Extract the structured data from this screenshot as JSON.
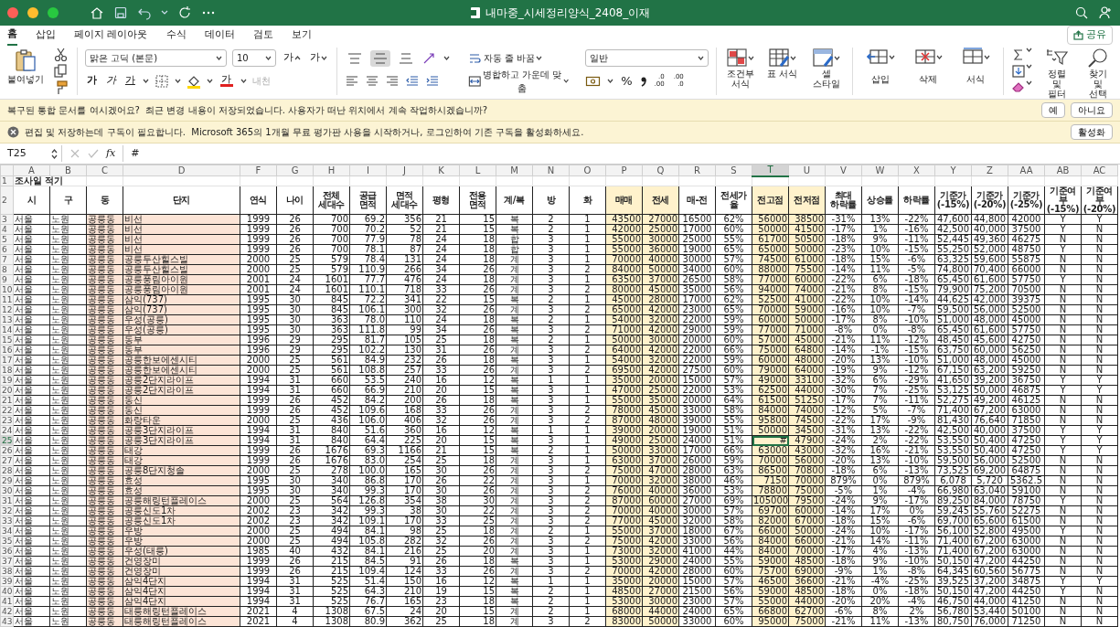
{
  "window": {
    "title": "내마중_시세정리양식_2408_이재"
  },
  "menu_tabs": [
    {
      "label": "홈",
      "selected": true
    },
    {
      "label": "삽입",
      "selected": false
    },
    {
      "label": "페이지 레이아웃",
      "selected": false
    },
    {
      "label": "수식",
      "selected": false
    },
    {
      "label": "데이터",
      "selected": false
    },
    {
      "label": "검토",
      "selected": false
    },
    {
      "label": "보기",
      "selected": false
    }
  ],
  "share_button": "공유",
  "ribbon": {
    "paste": "붙여넣기",
    "font_name": "맑은 고딕 (본문)",
    "font_size": "10",
    "grow_font": "가",
    "shrink_font": "가",
    "bold": "가",
    "italic": "가",
    "underline": "가",
    "font_color": "가",
    "phonetic": {
      "label": "내천",
      "disabled": true
    },
    "vertical_align": [
      {
        "selected": false
      },
      {
        "selected": true
      },
      {
        "selected": false
      }
    ],
    "wrap_text": "자동 줄 바꿈",
    "merge": "병합하고 가운데 맞춤",
    "number_format": "일반",
    "percent": "%",
    "decimals": [
      {
        "top": ".0",
        "bottom": ".00"
      },
      {
        "top": ".00",
        "bottom": ".0"
      }
    ],
    "styles": [
      "조건부 서식",
      "표 서식",
      "셀 스타일"
    ],
    "cells": [
      "삽입",
      "삭제",
      "서식"
    ],
    "sort_filter": "정렬 및 필터",
    "find_select": "찾기 및 선택"
  },
  "notifications": [
    {
      "kind": "info",
      "text": "복구된 통합 문서를 여시겠어요?  최근 변경 내용이 저장되었습니다. 사용자가 떠난 위치에서 계속 작업하시겠습니까?",
      "buttons": [
        "예",
        "아니요"
      ]
    },
    {
      "kind": "error",
      "text": "편집 및 저장하는데 구독이 필요합니다.  Microsoft 365의 1개월 무료 평가판 사용을 시작하거나, 로그인하여 기존 구독을 활성화하세요.",
      "buttons": [
        "활성화"
      ]
    }
  ],
  "formula_bar": {
    "cell_ref": "T25",
    "fx": "fx",
    "content": "#"
  },
  "sheet": {
    "columns": [
      {
        "letter": "A",
        "header": "시",
        "kind": "text",
        "color": "#ffffff",
        "selected": false
      },
      {
        "letter": "B",
        "header": "구",
        "kind": "text",
        "color": "#ffffff",
        "selected": false
      },
      {
        "letter": "C",
        "header": "동",
        "kind": "text",
        "color": "#fce4d6",
        "selected": false
      },
      {
        "letter": "D",
        "header": "단지",
        "kind": "text",
        "color": "#fce4d6",
        "selected": false
      },
      {
        "letter": "F",
        "header": "연식",
        "kind": "center",
        "color": "#ffffff",
        "selected": false
      },
      {
        "letter": "G",
        "header": "나이",
        "kind": "center",
        "color": "#ffffff",
        "selected": false
      },
      {
        "letter": "H",
        "header": "전체\n세대수",
        "kind": "number",
        "color": "#ffffff",
        "selected": false
      },
      {
        "letter": "I",
        "header": "공급\n면적",
        "kind": "number",
        "color": "#ffffff",
        "selected": false
      },
      {
        "letter": "J",
        "header": "면적\n세대수",
        "kind": "number",
        "color": "#ffffff",
        "selected": false
      },
      {
        "letter": "K",
        "header": "평형",
        "kind": "center",
        "color": "#ffffff",
        "selected": false
      },
      {
        "letter": "L",
        "header": "전용\n면적",
        "kind": "number",
        "color": "#ffffff",
        "selected": false
      },
      {
        "letter": "M",
        "header": "계/복",
        "kind": "center",
        "color": "#ffffff",
        "selected": false
      },
      {
        "letter": "N",
        "header": "방",
        "kind": "center",
        "color": "#ffffff",
        "selected": false
      },
      {
        "letter": "O",
        "header": "화",
        "kind": "center",
        "color": "#ffffff",
        "selected": false
      },
      {
        "letter": "P",
        "header": "매매",
        "kind": "number",
        "color": "#fff2cc",
        "header_highlight": true,
        "selected": false
      },
      {
        "letter": "Q",
        "header": "전세",
        "kind": "number",
        "color": "#fff2cc",
        "header_highlight": true,
        "selected": false
      },
      {
        "letter": "R",
        "header": "매-전",
        "kind": "center",
        "color": "#ffffff",
        "selected": false
      },
      {
        "letter": "S",
        "header": "전세가율",
        "kind": "center",
        "color": "#ffffff",
        "selected": false
      },
      {
        "letter": "T",
        "header": "전고점",
        "kind": "number",
        "color": "#fff2cc",
        "header_highlight": true,
        "selected": true
      },
      {
        "letter": "U",
        "header": "전저점",
        "kind": "number",
        "color": "#fff2cc",
        "header_highlight": true,
        "selected": false
      },
      {
        "letter": "V",
        "header": "최대\n하락률",
        "kind": "center",
        "color": "#ffffff",
        "selected": false
      },
      {
        "letter": "W",
        "header": "상승률",
        "kind": "center",
        "color": "#ffffff",
        "selected": false
      },
      {
        "letter": "X",
        "header": "하락률",
        "kind": "center",
        "color": "#ffffff",
        "selected": false
      },
      {
        "letter": "Y",
        "header": "기준가\n(-15%)",
        "kind": "center",
        "color": "#ffffff",
        "selected": false
      },
      {
        "letter": "Z",
        "header": "기준가\n(-20%)",
        "kind": "center",
        "color": "#ffffff",
        "selected": false
      },
      {
        "letter": "AA",
        "header": "기준가\n(-25%)",
        "kind": "center",
        "color": "#ffffff",
        "selected": false
      },
      {
        "letter": "AB",
        "header": "기준여부\n(-15%)",
        "kind": "center",
        "color": "#ffffff",
        "selected": false
      },
      {
        "letter": "AC",
        "header": "기준여부\n(-20%)",
        "kind": "center",
        "color": "#ffffff",
        "selected": false
      }
    ],
    "title_row": {
      "num": "1",
      "text": "조사일 적기",
      "selected": false
    },
    "header_row": {
      "num": "2",
      "selected": false
    },
    "rows": [
      {
        "num": "3",
        "selected": false,
        "cells": [
          "서울",
          "노원",
          "공릉동",
          "비선",
          "1999",
          "26",
          "700",
          "69.2",
          "356",
          "21",
          "15",
          "복",
          "2",
          "1",
          "43500",
          "27000",
          "16500",
          "62%",
          "56000",
          "38500",
          "-31%",
          "13%",
          "-22%",
          "47,600",
          "44,800",
          "42000",
          "Y",
          "Y"
        ]
      },
      {
        "num": "4",
        "selected": false,
        "cells": [
          "서울",
          "노원",
          "공릉동",
          "비선",
          "1999",
          "26",
          "700",
          "70.2",
          "52",
          "21",
          "15",
          "복",
          "2",
          "1",
          "42000",
          "25000",
          "17000",
          "60%",
          "50000",
          "41500",
          "-17%",
          "1%",
          "-16%",
          "42,500",
          "40,000",
          "37500",
          "Y",
          "N"
        ]
      },
      {
        "num": "5",
        "selected": false,
        "cells": [
          "서울",
          "노원",
          "공릉동",
          "비선",
          "1999",
          "26",
          "700",
          "77.9",
          "78",
          "24",
          "18",
          "합",
          "3",
          "1",
          "55000",
          "30000",
          "25000",
          "55%",
          "61700",
          "50500",
          "-18%",
          "9%",
          "-11%",
          "52,445",
          "49,360",
          "46275",
          "N",
          "N"
        ]
      },
      {
        "num": "6",
        "selected": false,
        "cells": [
          "서울",
          "노원",
          "공릉동",
          "비선",
          "1999",
          "26",
          "700",
          "78.1",
          "87",
          "24",
          "18",
          "합",
          "3",
          "1",
          "55000",
          "36000",
          "19000",
          "65%",
          "65000",
          "50000",
          "-23%",
          "10%",
          "-15%",
          "55,250",
          "52,000",
          "48750",
          "Y",
          "N"
        ]
      },
      {
        "num": "7",
        "selected": false,
        "cells": [
          "서울",
          "노원",
          "공릉동",
          "공릉두산힐스빌",
          "2000",
          "25",
          "579",
          "78.4",
          "131",
          "24",
          "18",
          "계",
          "3",
          "1",
          "70000",
          "40000",
          "30000",
          "57%",
          "74500",
          "61000",
          "-18%",
          "15%",
          "-6%",
          "63,325",
          "59,600",
          "55875",
          "N",
          "N"
        ]
      },
      {
        "num": "8",
        "selected": false,
        "cells": [
          "서울",
          "노원",
          "공릉동",
          "공릉두산힐스빌",
          "2000",
          "25",
          "579",
          "110.9",
          "266",
          "34",
          "26",
          "계",
          "3",
          "2",
          "84000",
          "50000",
          "34000",
          "60%",
          "88000",
          "75500",
          "-14%",
          "11%",
          "-5%",
          "74,800",
          "70,400",
          "66000",
          "N",
          "N"
        ]
      },
      {
        "num": "9",
        "selected": false,
        "cells": [
          "서울",
          "노원",
          "공릉동",
          "공릉풍림아이원",
          "2001",
          "24",
          "1601",
          "77.7",
          "476",
          "24",
          "18",
          "계",
          "3",
          "1",
          "63500",
          "37000",
          "26500",
          "58%",
          "77000",
          "60000",
          "-22%",
          "6%",
          "-18%",
          "65,450",
          "61,600",
          "57750",
          "Y",
          "N"
        ]
      },
      {
        "num": "10",
        "selected": false,
        "cells": [
          "서울",
          "노원",
          "공릉동",
          "공릉풍림아이원",
          "2001",
          "24",
          "1601",
          "110.1",
          "718",
          "33",
          "26",
          "계",
          "3",
          "2",
          "80000",
          "45000",
          "35000",
          "56%",
          "94000",
          "74000",
          "-21%",
          "8%",
          "-15%",
          "79,900",
          "75,200",
          "70500",
          "N",
          "N"
        ]
      },
      {
        "num": "11",
        "selected": false,
        "cells": [
          "서울",
          "노원",
          "공릉동",
          "삼익(737)",
          "1995",
          "30",
          "845",
          "72.2",
          "341",
          "22",
          "15",
          "복",
          "2",
          "1",
          "45000",
          "28000",
          "17000",
          "62%",
          "52500",
          "41000",
          "-22%",
          "10%",
          "-14%",
          "44,625",
          "42,000",
          "39375",
          "N",
          "N"
        ]
      },
      {
        "num": "12",
        "selected": false,
        "cells": [
          "서울",
          "노원",
          "공릉동",
          "삼익(737)",
          "1995",
          "30",
          "845",
          "106.1",
          "300",
          "32",
          "26",
          "계",
          "3",
          "2",
          "65000",
          "42000",
          "23000",
          "65%",
          "70000",
          "59000",
          "-16%",
          "10%",
          "-7%",
          "59,500",
          "56,000",
          "52500",
          "N",
          "N"
        ]
      },
      {
        "num": "13",
        "selected": false,
        "cells": [
          "서울",
          "노원",
          "공릉동",
          "우성(공릉)",
          "1995",
          "30",
          "363",
          "78.0",
          "110",
          "24",
          "18",
          "복",
          "2",
          "1",
          "54000",
          "32000",
          "22000",
          "59%",
          "60000",
          "50000",
          "-17%",
          "8%",
          "-10%",
          "51,000",
          "48,000",
          "45000",
          "N",
          "N"
        ]
      },
      {
        "num": "14",
        "selected": false,
        "cells": [
          "서울",
          "노원",
          "공릉동",
          "우성(공릉)",
          "1995",
          "30",
          "363",
          "111.8",
          "99",
          "34",
          "26",
          "복",
          "3",
          "2",
          "71000",
          "42000",
          "29000",
          "59%",
          "77000",
          "71000",
          "-8%",
          "0%",
          "-8%",
          "65,450",
          "61,600",
          "57750",
          "N",
          "N"
        ]
      },
      {
        "num": "15",
        "selected": false,
        "cells": [
          "서울",
          "노원",
          "공릉동",
          "동부",
          "1996",
          "29",
          "295",
          "81.7",
          "105",
          "25",
          "18",
          "복",
          "2",
          "1",
          "50000",
          "30000",
          "20000",
          "60%",
          "57000",
          "45000",
          "-21%",
          "11%",
          "-12%",
          "48,450",
          "45,600",
          "42750",
          "N",
          "N"
        ]
      },
      {
        "num": "16",
        "selected": false,
        "cells": [
          "서울",
          "노원",
          "공릉동",
          "동부",
          "1996",
          "29",
          "295",
          "102.2",
          "130",
          "31",
          "26",
          "계",
          "3",
          "2",
          "64000",
          "42000",
          "22000",
          "66%",
          "75000",
          "64800",
          "-14%",
          "-1%",
          "-15%",
          "63,750",
          "60,000",
          "56250",
          "N",
          "N"
        ]
      },
      {
        "num": "17",
        "selected": false,
        "cells": [
          "서울",
          "노원",
          "공릉동",
          "공릉한보에센시티",
          "2000",
          "25",
          "561",
          "84.9",
          "232",
          "26",
          "18",
          "복",
          "3",
          "1",
          "54000",
          "32000",
          "22000",
          "59%",
          "60000",
          "48000",
          "-20%",
          "13%",
          "-10%",
          "51,000",
          "48,000",
          "45000",
          "N",
          "N"
        ]
      },
      {
        "num": "18",
        "selected": false,
        "cells": [
          "서울",
          "노원",
          "공릉동",
          "공릉한보에센시티",
          "2000",
          "25",
          "561",
          "108.8",
          "257",
          "33",
          "26",
          "계",
          "3",
          "2",
          "69500",
          "42000",
          "27500",
          "60%",
          "79000",
          "64000",
          "-19%",
          "9%",
          "-12%",
          "67,150",
          "63,200",
          "59250",
          "N",
          "N"
        ]
      },
      {
        "num": "19",
        "selected": false,
        "cells": [
          "서울",
          "노원",
          "공릉동",
          "공릉2단지라이프",
          "1994",
          "31",
          "660",
          "53.5",
          "240",
          "16",
          "12",
          "복",
          "1",
          "1",
          "35000",
          "20000",
          "15000",
          "57%",
          "49000",
          "33100",
          "-32%",
          "6%",
          "-29%",
          "41,650",
          "39,200",
          "36750",
          "Y",
          "Y"
        ]
      },
      {
        "num": "20",
        "selected": false,
        "cells": [
          "서울",
          "노원",
          "공릉동",
          "공릉2단지라이프",
          "1994",
          "31",
          "660",
          "66.9",
          "210",
          "20",
          "15",
          "복",
          "3",
          "1",
          "47000",
          "25000",
          "22000",
          "53%",
          "62500",
          "44000",
          "-30%",
          "7%",
          "-25%",
          "53,125",
          "50,000",
          "46875",
          "Y",
          "Y"
        ]
      },
      {
        "num": "21",
        "selected": false,
        "cells": [
          "서울",
          "노원",
          "공릉동",
          "동신",
          "1999",
          "26",
          "452",
          "84.2",
          "200",
          "26",
          "18",
          "복",
          "3",
          "1",
          "55000",
          "35000",
          "20000",
          "64%",
          "61500",
          "51250",
          "-17%",
          "7%",
          "-11%",
          "52,275",
          "49,200",
          "46125",
          "N",
          "N"
        ]
      },
      {
        "num": "22",
        "selected": false,
        "cells": [
          "서울",
          "노원",
          "공릉동",
          "동신",
          "1999",
          "26",
          "452",
          "109.6",
          "168",
          "33",
          "26",
          "계",
          "3",
          "2",
          "78000",
          "45000",
          "33000",
          "58%",
          "84000",
          "74000",
          "-12%",
          "5%",
          "-7%",
          "71,400",
          "67,200",
          "63000",
          "N",
          "N"
        ]
      },
      {
        "num": "23",
        "selected": false,
        "cells": [
          "서울",
          "노원",
          "공릉동",
          "화랑타운",
          "2000",
          "25",
          "436",
          "106.0",
          "406",
          "32",
          "26",
          "계",
          "3",
          "2",
          "87000",
          "48000",
          "39000",
          "55%",
          "95800",
          "74500",
          "-22%",
          "17%",
          "-9%",
          "81,430",
          "76,640",
          "71850",
          "N",
          "N"
        ]
      },
      {
        "num": "24",
        "selected": false,
        "cells": [
          "서울",
          "노원",
          "공릉동",
          "공릉3단지라이프",
          "1994",
          "31",
          "840",
          "51.6",
          "360",
          "16",
          "12",
          "복",
          "1",
          "1",
          "39000",
          "20000",
          "19000",
          "51%",
          "50000",
          "34500",
          "-31%",
          "13%",
          "-22%",
          "42,500",
          "40,000",
          "37500",
          "Y",
          "Y"
        ]
      },
      {
        "num": "25",
        "selected": true,
        "cells": [
          "서울",
          "노원",
          "공릉동",
          "공릉3단지라이프",
          "1994",
          "31",
          "840",
          "64.4",
          "225",
          "20",
          "15",
          "복",
          "3",
          "1",
          "49000",
          "25000",
          "24000",
          "51%",
          "#",
          "47900",
          "-24%",
          "2%",
          "-22%",
          "53,550",
          "50,400",
          "47250",
          "Y",
          "Y"
        ]
      },
      {
        "num": "26",
        "selected": false,
        "cells": [
          "서울",
          "노원",
          "공릉동",
          "태강",
          "1999",
          "26",
          "1676",
          "69.3",
          "1166",
          "21",
          "15",
          "복",
          "2",
          "1",
          "50000",
          "33000",
          "17000",
          "66%",
          "63000",
          "43000",
          "-32%",
          "16%",
          "-21%",
          "53,550",
          "50,400",
          "47250",
          "Y",
          "Y"
        ]
      },
      {
        "num": "27",
        "selected": false,
        "cells": [
          "서울",
          "노원",
          "공릉동",
          "태강",
          "1999",
          "26",
          "1676",
          "83.0",
          "254",
          "25",
          "18",
          "계",
          "3",
          "1",
          "63000",
          "37000",
          "26000",
          "59%",
          "70000",
          "56000",
          "-20%",
          "13%",
          "-10%",
          "59,500",
          "56,000",
          "52500",
          "N",
          "N"
        ]
      },
      {
        "num": "28",
        "selected": false,
        "cells": [
          "서울",
          "노원",
          "공릉동",
          "공릉8단지청솔",
          "2000",
          "25",
          "278",
          "100.0",
          "165",
          "30",
          "26",
          "계",
          "3",
          "2",
          "75000",
          "47000",
          "28000",
          "63%",
          "86500",
          "70800",
          "-18%",
          "6%",
          "-13%",
          "73,525",
          "69,200",
          "64875",
          "N",
          "N"
        ]
      },
      {
        "num": "29",
        "selected": false,
        "cells": [
          "서울",
          "노원",
          "공릉동",
          "효성",
          "1995",
          "30",
          "340",
          "86.8",
          "170",
          "26",
          "22",
          "계",
          "3",
          "1",
          "70000",
          "32000",
          "38000",
          "46%",
          "7150",
          "70000",
          "879%",
          "0%",
          "879%",
          "6,078",
          "5,720",
          "5362.5",
          "N",
          "N"
        ]
      },
      {
        "num": "30",
        "selected": false,
        "cells": [
          "서울",
          "노원",
          "공릉동",
          "효성",
          "1995",
          "30",
          "340",
          "99.3",
          "170",
          "30",
          "26",
          "계",
          "3",
          "2",
          "76000",
          "40000",
          "36000",
          "53%",
          "78800",
          "75000",
          "-5%",
          "1%",
          "-4%",
          "66,980",
          "63,040",
          "59100",
          "N",
          "N"
        ]
      },
      {
        "num": "31",
        "selected": false,
        "cells": [
          "서울",
          "노원",
          "공릉동",
          "공릉해링턴플레이스",
          "2000",
          "25",
          "564",
          "126.8",
          "354",
          "38",
          "30",
          "계",
          "3",
          "2",
          "87000",
          "60000",
          "27000",
          "69%",
          "105000",
          "79500",
          "-24%",
          "9%",
          "-17%",
          "89,250",
          "84,000",
          "78750",
          "Y",
          "N"
        ]
      },
      {
        "num": "32",
        "selected": false,
        "cells": [
          "서울",
          "노원",
          "공릉동",
          "공릉신도1차",
          "2002",
          "23",
          "342",
          "99.3",
          "38",
          "30",
          "22",
          "계",
          "3",
          "2",
          "70000",
          "40000",
          "30000",
          "57%",
          "69700",
          "60000",
          "-14%",
          "17%",
          "0%",
          "59,245",
          "55,760",
          "52275",
          "N",
          "N"
        ]
      },
      {
        "num": "33",
        "selected": false,
        "cells": [
          "서울",
          "노원",
          "공릉동",
          "공릉신도1차",
          "2002",
          "23",
          "342",
          "109.1",
          "170",
          "33",
          "25",
          "계",
          "3",
          "2",
          "77000",
          "45000",
          "32000",
          "58%",
          "82000",
          "67000",
          "-18%",
          "15%",
          "-6%",
          "69,700",
          "65,600",
          "61500",
          "N",
          "N"
        ]
      },
      {
        "num": "34",
        "selected": false,
        "cells": [
          "서울",
          "노원",
          "공릉동",
          "우방",
          "2000",
          "25",
          "494",
          "84.1",
          "98",
          "25",
          "18",
          "계",
          "2",
          "1",
          "55000",
          "37000",
          "18000",
          "67%",
          "66000",
          "50000",
          "-24%",
          "10%",
          "-17%",
          "56,100",
          "52,800",
          "49500",
          "Y",
          "N"
        ]
      },
      {
        "num": "35",
        "selected": false,
        "cells": [
          "서울",
          "노원",
          "공릉동",
          "우방",
          "2000",
          "25",
          "494",
          "105.8",
          "282",
          "32",
          "26",
          "계",
          "3",
          "2",
          "75000",
          "42000",
          "33000",
          "56%",
          "84000",
          "66000",
          "-21%",
          "14%",
          "-11%",
          "71,400",
          "67,200",
          "63000",
          "N",
          "N"
        ]
      },
      {
        "num": "36",
        "selected": false,
        "cells": [
          "서울",
          "노원",
          "공릉동",
          "우성(태릉)",
          "1985",
          "40",
          "432",
          "84.1",
          "216",
          "25",
          "20",
          "계",
          "3",
          "1",
          "73000",
          "32000",
          "41000",
          "44%",
          "84000",
          "70000",
          "-17%",
          "4%",
          "-13%",
          "71,400",
          "67,200",
          "63000",
          "N",
          "N"
        ]
      },
      {
        "num": "37",
        "selected": false,
        "cells": [
          "서울",
          "노원",
          "공릉동",
          "건영장미",
          "1999",
          "26",
          "215",
          "84.5",
          "91",
          "26",
          "18",
          "복",
          "3",
          "1",
          "53000",
          "29000",
          "24000",
          "55%",
          "59000",
          "48500",
          "-18%",
          "9%",
          "-10%",
          "50,150",
          "47,200",
          "44250",
          "N",
          "N"
        ]
      },
      {
        "num": "38",
        "selected": false,
        "cells": [
          "서울",
          "노원",
          "공릉동",
          "건영장미",
          "1999",
          "26",
          "215",
          "109.4",
          "124",
          "33",
          "26",
          "계",
          "3",
          "2",
          "70000",
          "42000",
          "28000",
          "60%",
          "75700",
          "69000",
          "-9%",
          "1%",
          "-8%",
          "64,345",
          "60,560",
          "56775",
          "N",
          "N"
        ]
      },
      {
        "num": "39",
        "selected": false,
        "cells": [
          "서울",
          "노원",
          "공릉동",
          "삼익4단지",
          "1994",
          "31",
          "525",
          "51.4",
          "150",
          "16",
          "12",
          "복",
          "1",
          "1",
          "35000",
          "20000",
          "15000",
          "57%",
          "46500",
          "36600",
          "-21%",
          "-4%",
          "-25%",
          "39,525",
          "37,200",
          "34875",
          "Y",
          "Y"
        ]
      },
      {
        "num": "40",
        "selected": false,
        "cells": [
          "서울",
          "노원",
          "공릉동",
          "삼익4단지",
          "1994",
          "31",
          "525",
          "64.3",
          "210",
          "19",
          "15",
          "복",
          "2",
          "1",
          "48500",
          "27000",
          "21500",
          "56%",
          "59000",
          "48500",
          "-18%",
          "0%",
          "-18%",
          "50,150",
          "47,200",
          "44250",
          "Y",
          "N"
        ]
      },
      {
        "num": "41",
        "selected": false,
        "cells": [
          "서울",
          "노원",
          "공릉동",
          "삼익4단지",
          "1994",
          "31",
          "525",
          "76.7",
          "165",
          "23",
          "18",
          "복",
          "2",
          "1",
          "53000",
          "30000",
          "23000",
          "57%",
          "55000",
          "44000",
          "-20%",
          "20%",
          "-4%",
          "46,750",
          "44,000",
          "41250",
          "N",
          "N"
        ]
      },
      {
        "num": "42",
        "selected": false,
        "cells": [
          "서울",
          "노원",
          "공릉동",
          "태릉해링턴플레이스",
          "2021",
          "4",
          "1308",
          "67.5",
          "24",
          "20",
          "15",
          "계",
          "2",
          "1",
          "68000",
          "44000",
          "24000",
          "65%",
          "66800",
          "62700",
          "-6%",
          "8%",
          "2%",
          "56,780",
          "53,440",
          "50100",
          "N",
          "N"
        ]
      },
      {
        "num": "43",
        "selected": false,
        "cells": [
          "서울",
          "노원",
          "공릉동",
          "태릉해링턴플레이스",
          "2021",
          "4",
          "1308",
          "80.9",
          "362",
          "25",
          "18",
          "계",
          "3",
          "2",
          "83000",
          "50000",
          "33000",
          "60%",
          "95000",
          "75000",
          "-21%",
          "11%",
          "-13%",
          "80,750",
          "76,000",
          "71250",
          "N",
          "N"
        ]
      }
    ]
  }
}
